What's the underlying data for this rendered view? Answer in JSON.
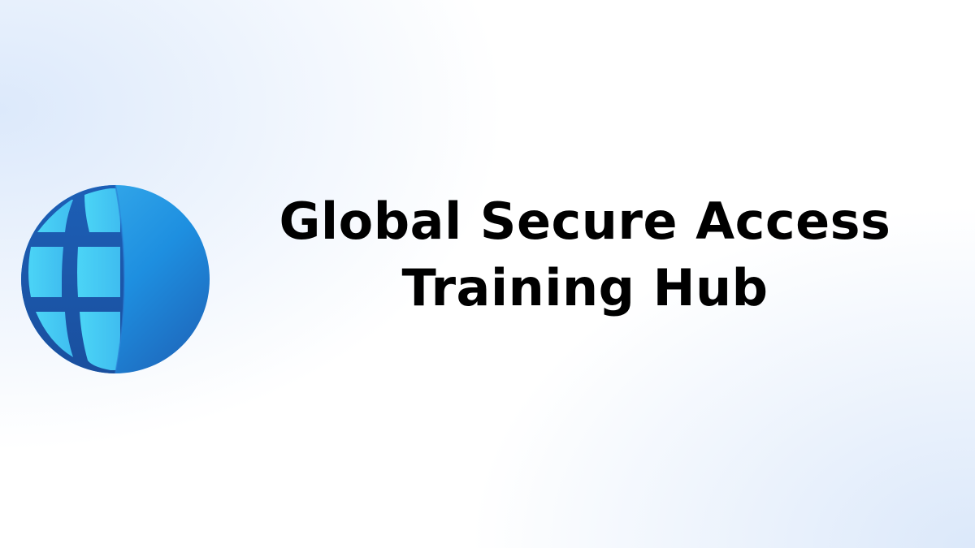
{
  "banner": {
    "logo_icon": "globe-icon",
    "title_line1": "Global Secure Access",
    "title_line2": "Training Hub"
  },
  "colors": {
    "text": "#000000",
    "globe_dark_blue": "#1E5AA8",
    "globe_light_blue": "#4FC6F2",
    "background_tint": "#DCE9FB"
  }
}
